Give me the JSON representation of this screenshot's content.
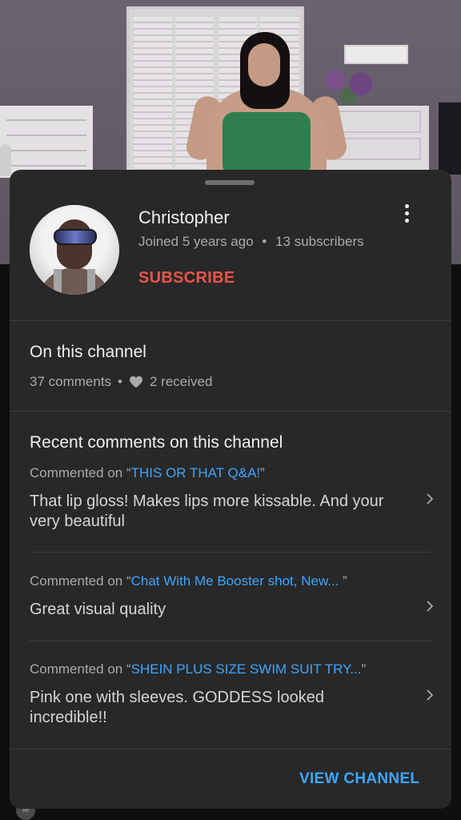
{
  "channel": {
    "name": "Christopher",
    "joined": "Joined 5 years ago",
    "subscribers": "13 subscribers",
    "meta_separator": "•",
    "subscribe_label": "SUBSCRIBE",
    "more_icon": "more-vert-icon"
  },
  "on_channel": {
    "title": "On this channel",
    "comments_count": "37 comments",
    "separator": "•",
    "hearts_received": "2 received",
    "heart_icon": "heart-icon"
  },
  "recent": {
    "title": "Recent comments on this channel",
    "prefix": "Commented on ",
    "items": [
      {
        "video_title": "THIS OR THAT Q&A!",
        "quote_open": "“",
        "quote_close": "”",
        "comment": "That lip gloss!  Makes lips more kissable. And your very beautiful"
      },
      {
        "video_title": "Chat With Me Booster shot, New...  ",
        "quote_open": "“",
        "quote_close": "”",
        "comment": "Great visual quality"
      },
      {
        "video_title": "SHEIN PLUS SIZE SWIM SUIT TRY...",
        "quote_open": "“",
        "quote_close": "”",
        "comment": "Pink one with sleeves. GODDESS looked incredible!!"
      }
    ]
  },
  "footer": {
    "view_channel_label": "VIEW CHANNEL"
  },
  "background": {
    "peek_avatar_letter": "M"
  },
  "colors": {
    "accent_link": "#3ea6ff",
    "subscribe_red": "#e9564a",
    "sheet_bg": "#282828"
  }
}
